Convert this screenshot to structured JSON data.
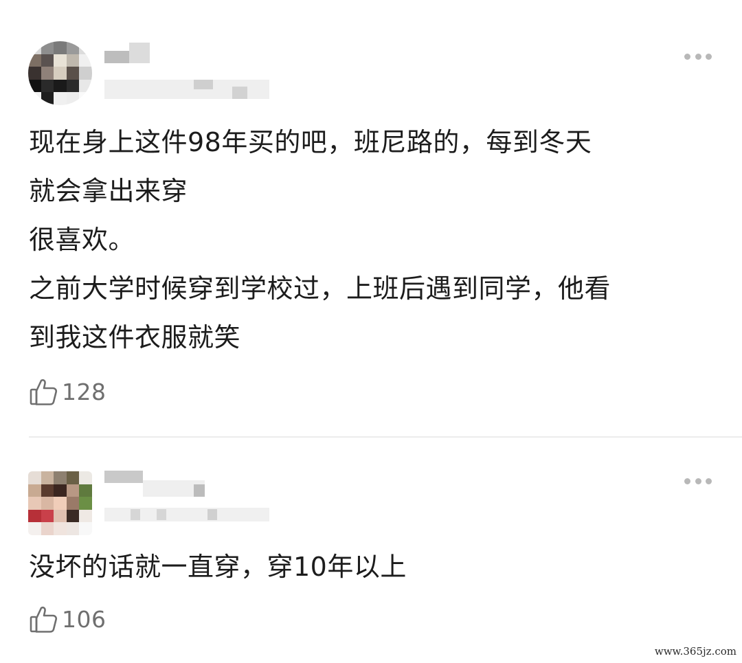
{
  "comments": [
    {
      "lines": [
        "现在身上这件98年买的吧，班尼路的，每到冬天",
        "就会拿出来穿",
        "很喜欢。",
        "之前大学时候穿到学校过，上班后遇到同学，他看",
        "到我这件衣服就笑"
      ],
      "likes": "128",
      "like_icon": "thumbs-up-icon",
      "more_icon": "more-options-icon"
    },
    {
      "lines": [
        "没坏的话就一直穿，穿10年以上"
      ],
      "likes": "106",
      "like_icon": "thumbs-up-icon",
      "more_icon": "more-options-icon"
    }
  ],
  "watermark": "www.365jz.com",
  "colors": {
    "text": "#1c1c1c",
    "muted": "#6f6f6f",
    "divider": "#ececec",
    "dots": "#b8b8b8"
  }
}
